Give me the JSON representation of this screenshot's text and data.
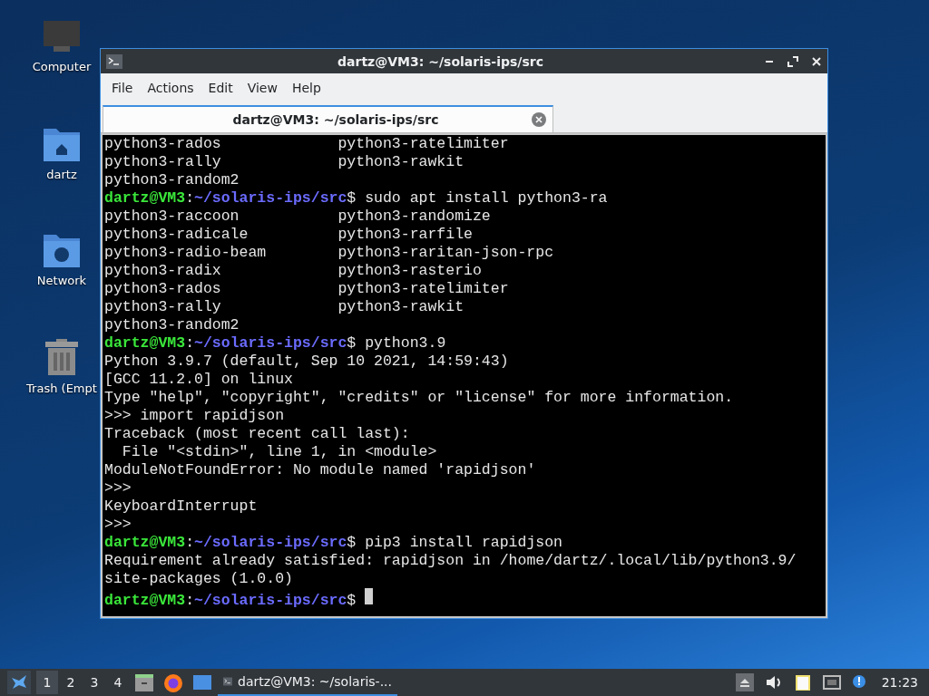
{
  "desktop_icons": [
    {
      "kind": "computer",
      "label": "Computer"
    },
    {
      "kind": "home",
      "label": "dartz"
    },
    {
      "kind": "network",
      "label": "Network"
    },
    {
      "kind": "trash",
      "label": "Trash (Empt"
    }
  ],
  "window": {
    "title": "dartz@VM3: ~/solaris-ips/src",
    "menu": [
      "File",
      "Actions",
      "Edit",
      "View",
      "Help"
    ],
    "tabs": [
      {
        "label": "dartz@VM3: ~/solaris-ips/src",
        "selected": true
      }
    ],
    "terminal": {
      "lines": [
        {
          "kind": "columns",
          "columns": [
            "python3-rados",
            "python3-ratelimiter"
          ]
        },
        {
          "kind": "columns",
          "columns": [
            "python3-rally",
            "python3-rawkit"
          ]
        },
        {
          "kind": "columns",
          "columns": [
            "python3-random2"
          ]
        },
        {
          "kind": "prompt",
          "user": "dartz@VM3",
          "sep": ":",
          "path": "~/solaris-ips/src",
          "sigil": "$",
          "command": "sudo apt install python3-ra"
        },
        {
          "kind": "columns",
          "columns": [
            "python3-raccoon",
            "python3-randomize"
          ]
        },
        {
          "kind": "columns",
          "columns": [
            "python3-radicale",
            "python3-rarfile"
          ]
        },
        {
          "kind": "columns",
          "columns": [
            "python3-radio-beam",
            "python3-raritan-json-rpc"
          ]
        },
        {
          "kind": "columns",
          "columns": [
            "python3-radix",
            "python3-rasterio"
          ]
        },
        {
          "kind": "columns",
          "columns": [
            "python3-rados",
            "python3-ratelimiter"
          ]
        },
        {
          "kind": "columns",
          "columns": [
            "python3-rally",
            "python3-rawkit"
          ]
        },
        {
          "kind": "columns",
          "columns": [
            "python3-random2"
          ]
        },
        {
          "kind": "prompt",
          "user": "dartz@VM3",
          "sep": ":",
          "path": "~/solaris-ips/src",
          "sigil": "$",
          "command": "python3.9"
        },
        {
          "kind": "output",
          "text": "Python 3.9.7 (default, Sep 10 2021, 14:59:43)"
        },
        {
          "kind": "output",
          "text": "[GCC 11.2.0] on linux"
        },
        {
          "kind": "output",
          "text": "Type \"help\", \"copyright\", \"credits\" or \"license\" for more information."
        },
        {
          "kind": "output",
          "text": ">>> import rapidjson"
        },
        {
          "kind": "output",
          "text": "Traceback (most recent call last):"
        },
        {
          "kind": "output",
          "text": "  File \"<stdin>\", line 1, in <module>"
        },
        {
          "kind": "output",
          "text": "ModuleNotFoundError: No module named 'rapidjson'"
        },
        {
          "kind": "output",
          "text": ">>>"
        },
        {
          "kind": "output",
          "text": "KeyboardInterrupt"
        },
        {
          "kind": "output",
          "text": ">>>"
        },
        {
          "kind": "prompt",
          "user": "dartz@VM3",
          "sep": ":",
          "path": "~/solaris-ips/src",
          "sigil": "$",
          "command": "pip3 install rapidjson"
        },
        {
          "kind": "output",
          "text": "Requirement already satisfied: rapidjson in /home/dartz/.local/lib/python3.9/"
        },
        {
          "kind": "output",
          "text": "site-packages (1.0.0)"
        },
        {
          "kind": "prompt",
          "user": "dartz@VM3",
          "sep": ":",
          "path": "~/solaris-ips/src",
          "sigil": "$",
          "cursor": true
        }
      ]
    }
  },
  "taskbar": {
    "workspaces": [
      {
        "label": "1",
        "selected": true
      },
      {
        "label": "2",
        "selected": false
      },
      {
        "label": "3",
        "selected": false
      },
      {
        "label": "4",
        "selected": false
      }
    ],
    "tasks": [
      {
        "label": "dartz@VM3: ~/solaris-...",
        "selected": true
      }
    ],
    "clock": "21:23"
  }
}
